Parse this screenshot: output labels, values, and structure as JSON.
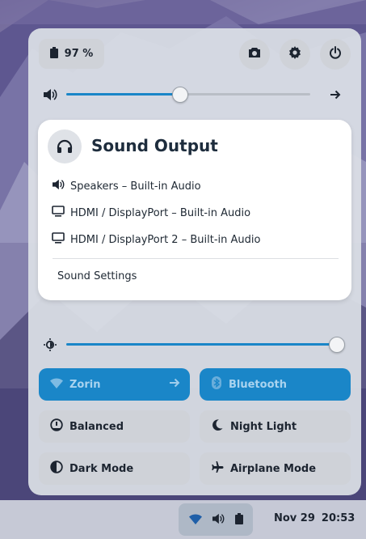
{
  "top_bar": {
    "battery_label": "97 %"
  },
  "sound_output": {
    "title": "Sound Output",
    "devices": [
      {
        "label": "Speakers – Built-in Audio",
        "icon": "speaker-icon"
      },
      {
        "label": "HDMI / DisplayPort – Built-in Audio",
        "icon": "monitor-icon"
      },
      {
        "label": "HDMI / DisplayPort 2 – Built-in Audio",
        "icon": "monitor-icon"
      }
    ],
    "settings_label": "Sound Settings"
  },
  "volume": {
    "level_fraction": 0.47
  },
  "brightness": {
    "level_fraction": 1.0
  },
  "tiles": {
    "wifi": {
      "label": "Zorin",
      "active": true
    },
    "bluetooth": {
      "label": "Bluetooth",
      "active": true
    },
    "power_mode": {
      "label": "Balanced",
      "active": false
    },
    "night_light": {
      "label": "Night Light",
      "active": false
    },
    "dark_mode": {
      "label": "Dark Mode",
      "active": false
    },
    "airplane_mode": {
      "label": "Airplane Mode",
      "active": false
    }
  },
  "taskbar": {
    "date": "Nov 29",
    "time": "20:53"
  },
  "colors": {
    "accent": "#1a86c8",
    "panel_bg": "#dce0e6",
    "text": "#1c2430"
  }
}
